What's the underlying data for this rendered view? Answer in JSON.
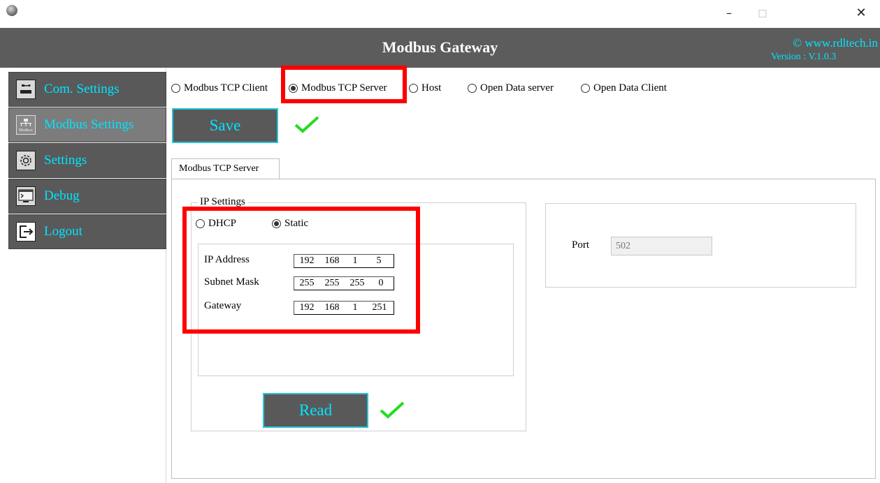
{
  "window": {
    "minimize": "–",
    "maximize": "□",
    "close": "✕"
  },
  "header": {
    "title": "Modbus Gateway",
    "copyright": "© www.rdltech.in",
    "version": "Version : V.1.0.3"
  },
  "sidebar": {
    "items": [
      {
        "label": "Com. Settings",
        "icon": "com-port-icon"
      },
      {
        "label": "Modbus Settings",
        "icon": "modbus-icon",
        "active": true,
        "icon_text": "Modbus"
      },
      {
        "label": "Settings",
        "icon": "gear-icon"
      },
      {
        "label": "Debug",
        "icon": "terminal-icon"
      },
      {
        "label": "Logout",
        "icon": "logout-icon"
      }
    ]
  },
  "mode_options": [
    {
      "label": "Modbus TCP Client",
      "selected": false
    },
    {
      "label": "Modbus TCP Server",
      "selected": true
    },
    {
      "label": "Host",
      "selected": false
    },
    {
      "label": "Open Data server",
      "selected": false
    },
    {
      "label": "Open Data Client",
      "selected": false
    }
  ],
  "save_button": "Save",
  "read_button": "Read",
  "tab_label": "Modbus TCP Server",
  "ip_settings": {
    "legend": "IP Settings",
    "dhcp_label": "DHCP",
    "static_label": "Static",
    "selected": "Static",
    "ip_address": {
      "label": "IP Address",
      "octets": [
        "192",
        "168",
        "1",
        "5"
      ]
    },
    "subnet_mask": {
      "label": "Subnet Mask",
      "octets": [
        "255",
        "255",
        "255",
        "0"
      ]
    },
    "gateway": {
      "label": "Gateway",
      "octets": [
        "192",
        "168",
        "1",
        "251"
      ]
    }
  },
  "port": {
    "label": "Port",
    "value": "502"
  },
  "colors": {
    "header_bg": "#5c5c5c",
    "accent_cyan": "#00e5ff",
    "highlight_red": "#ff0000",
    "check_green": "#22dd22"
  }
}
